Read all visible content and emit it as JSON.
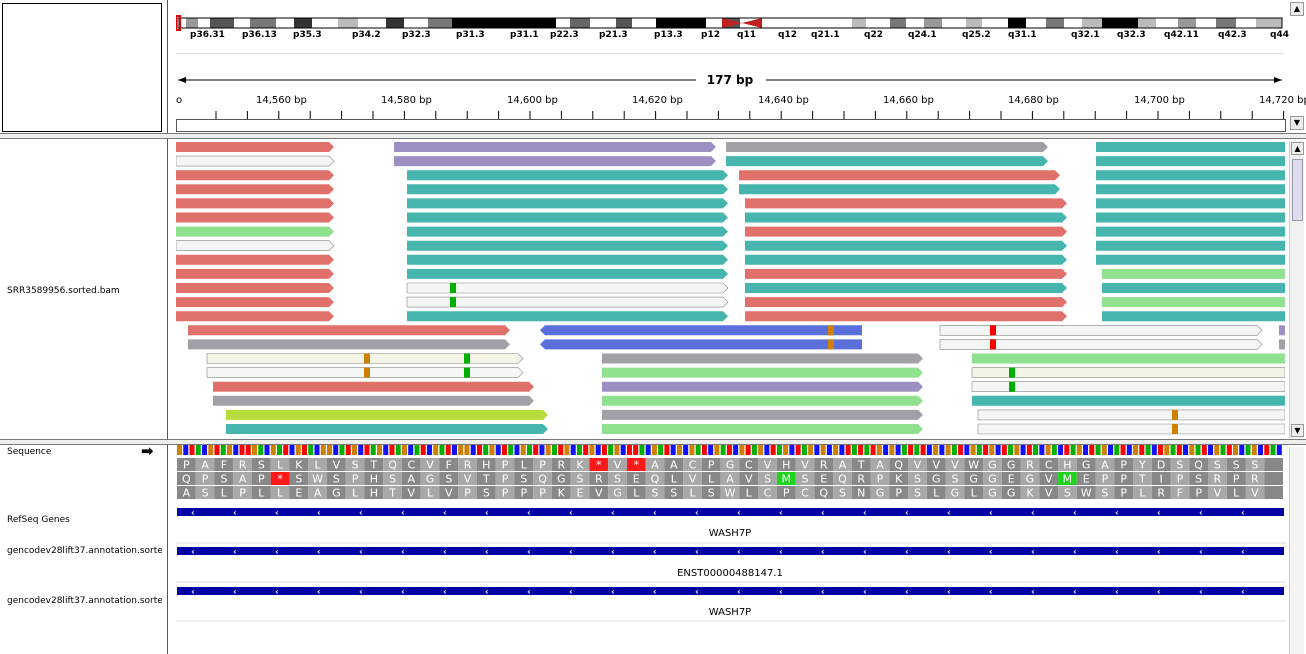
{
  "ideogram": {
    "bands": [
      "p36.31",
      "p36.13",
      "p35.3",
      "p34.2",
      "p32.3",
      "p31.3",
      "p31.1",
      "p22.3",
      "p21.3",
      "p13.3",
      "p12",
      "q11",
      "q12",
      "q21.1",
      "q22",
      "q24.1",
      "q25.2",
      "q31.1",
      "q32.1",
      "q32.3",
      "q42.11",
      "q42.3",
      "q44"
    ]
  },
  "ruler": {
    "span": "177 bp",
    "ticks": [
      "14,560 bp",
      "14,580 bp",
      "14,600 bp",
      "14,620 bp",
      "14,640 bp",
      "14,660 bp",
      "14,680 bp",
      "14,700 bp",
      "14,720 bp"
    ]
  },
  "tracks": {
    "bam": "SRR3589956.sorted.bam",
    "sequence": "Sequence",
    "refseq": "RefSeq Genes",
    "gencode1": "gencodev28lift37.annotation.sorted.gtf",
    "gencode2": "gencodev28lift37.annotation.sorted.gtf"
  },
  "features": {
    "refseq": "WASH7P",
    "gencode1": "ENST00000488147.1",
    "gencode2": "WASH7P"
  },
  "translation": {
    "frame1": "PAFRSLKLVSTQCVFRHPLPRK*V*AACPGCVHVRATAQVVVWGGRCHGAPYDSQSSS",
    "frame2": "QPSAP*SWSPHSAGSVTPSQGSRSEQLVLAVSMSEQRPKSGSGGEGVMEPPTIPSRPR",
    "frame3": "ASLPLLEAGLHTVLVPSPPPKEVGLSSLSWLCPCQSNGPSLGLGGKVSWSPLRFPVLV"
  },
  "colors": {
    "red": "#e0706a",
    "teal": "#45b5ae",
    "purple": "#9e8fc2",
    "green": "#8fe08f",
    "blue": "#5a6fd9",
    "gray": "#a39fa7",
    "lime": "#b6dc3e",
    "base_A": "#00b000",
    "base_C": "#1010ff",
    "base_G": "#d08000",
    "base_T": "#ff0000",
    "gene": "#0000a5"
  }
}
